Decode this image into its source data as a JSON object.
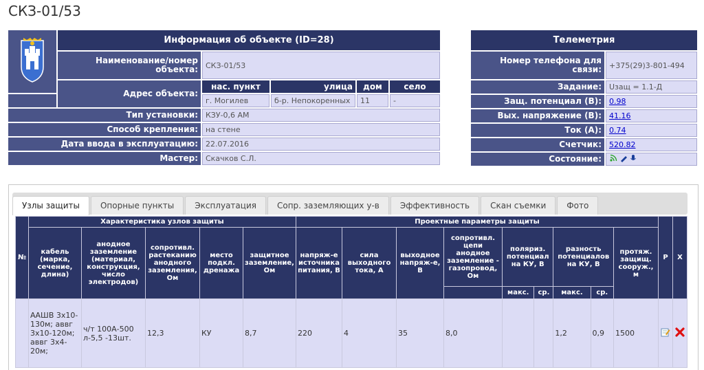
{
  "page_title": "СКЗ-01/53",
  "info": {
    "header": "Информация об объекте (ID=28)",
    "name_label": "Наименование/номер объекта:",
    "name_value": "СКЗ-01/53",
    "address_label": "Адрес объекта:",
    "address_cols": [
      "нас. пункт",
      "улица",
      "дом",
      "село"
    ],
    "address_vals": [
      "г. Могилев",
      "б-р. Непокоренных",
      "11",
      "-"
    ],
    "type_label": "Тип установки:",
    "type_value": "КЗУ-0,6 АМ",
    "mount_label": "Способ крепления:",
    "mount_value": "на стене",
    "date_label": "Дата ввода в эксплуатацию:",
    "date_value": "22.07.2016",
    "master_label": "Мастер:",
    "master_value": "Скачков С.Л."
  },
  "telemetry": {
    "header": "Телеметрия",
    "phone_label": "Номер телефона для связи:",
    "phone_value": "+375(29)3-801-494",
    "task_label": "Задание:",
    "task_value": "Uзащ = 1.1-Д",
    "potential_label": "Защ. потенциал (В):",
    "potential_value": "0.98",
    "voltage_label": "Вых. напряжение (В):",
    "voltage_value": "41.16",
    "current_label": "Ток (А):",
    "current_value": "0.74",
    "counter_label": "Счетчик:",
    "counter_value": "520.82",
    "state_label": "Состояние:"
  },
  "tabs": [
    "Узлы защиты",
    "Опорные пункты",
    "Эксплуатация",
    "Сопр. заземляющих у-в",
    "Эффективность",
    "Скан съемки",
    "Фото"
  ],
  "nodes": {
    "num": "№",
    "group1": "Характеристика узлов защиты",
    "group2": "Проектные параметры защиты",
    "cols": [
      "кабель (марка, сечение, длина)",
      "анодное заземление (материал, конструкция, число электродов)",
      "сопротивл. растеканию анодного заземления, Ом",
      "место подкл. дренажа",
      "защитное заземление, Ом",
      "напряж-е источника питания, В",
      "сила выходного тока, А",
      "выходное напряж-е, В",
      "сопротивл. цепи анодное заземление - газопровод, Ом",
      "поляриз. потенциал на КУ, В",
      "разность потенциалов на КУ, В",
      "протяж. защищ. сооруж., м",
      "Р",
      "Х"
    ],
    "sub_max": "макс.",
    "sub_avg": "ср.",
    "row": {
      "cable": "ААШВ 3х10-130м; аввг 3х10-120м; аввг 3х4-20м;",
      "anode": "ч/т 100А-500 л-5,5 -13шт.",
      "resist": "12,3",
      "drain": "КУ",
      "ground": "8,7",
      "supply": "220",
      "current": "4",
      "outv": "35",
      "circuit": "8,0",
      "pol_max": "",
      "pol_avg": "",
      "diff_max": "1,2",
      "diff_avg": "0,9",
      "length": "1500"
    }
  }
}
